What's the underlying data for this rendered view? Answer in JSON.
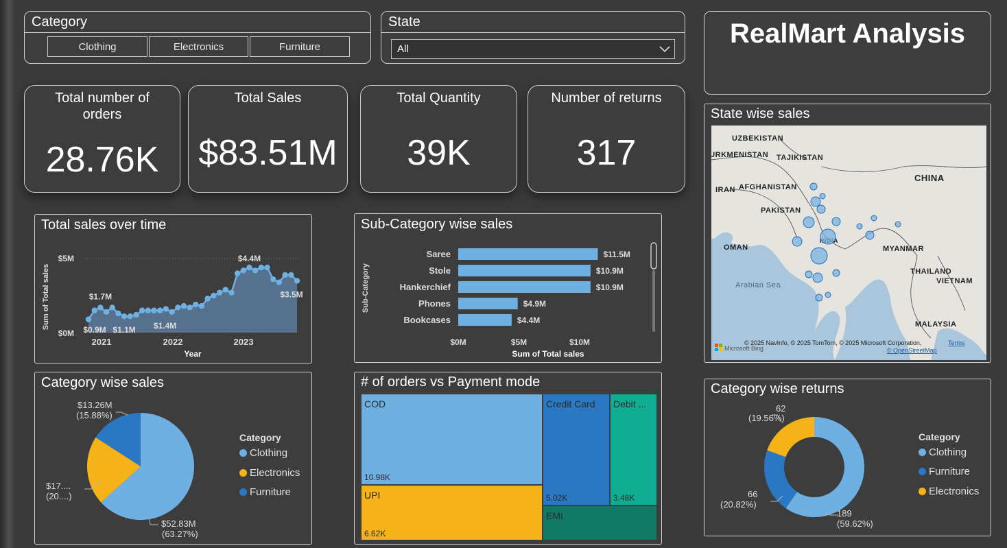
{
  "colors": {
    "light_blue": "#6fb0e2",
    "dark_blue": "#2a78c4",
    "yellow": "#f6b318",
    "teal": "#0fae92",
    "dark_teal": "#117a65",
    "panel": "#3d3d3d"
  },
  "slicers": {
    "category": {
      "title": "Category",
      "options": [
        "Clothing",
        "Electronics",
        "Furniture"
      ]
    },
    "state": {
      "title": "State",
      "selected": "All"
    }
  },
  "title": "RealMart Analysis",
  "kpis": [
    {
      "title": "Total number of orders",
      "value": "28.76K"
    },
    {
      "title": "Total Sales",
      "value": "$83.51M"
    },
    {
      "title": "Total Quantity",
      "value": "39K"
    },
    {
      "title": "Number of returns",
      "value": "317"
    }
  ],
  "sales_over_time": {
    "title": "Total sales over time",
    "chart_data": {
      "type": "area",
      "xlabel": "Year",
      "ylabel": "Sum of Total sales",
      "x_ticks": [
        "2021",
        "2022",
        "2023"
      ],
      "y_ticks": [
        "$0M",
        "$5M"
      ],
      "ylim": [
        0,
        5.8
      ],
      "values": [
        0.9,
        1.5,
        1.7,
        1.4,
        1.7,
        1.3,
        1.1,
        1.1,
        1.2,
        1.5,
        1.5,
        1.5,
        1.5,
        1.6,
        1.4,
        1.7,
        1.8,
        1.7,
        1.9,
        1.8,
        2.3,
        2.5,
        2.7,
        2.9,
        2.7,
        4.0,
        4.2,
        4.4,
        4.2,
        4.4,
        4.4,
        3.6,
        3.4,
        3.9,
        3.9,
        3.5
      ],
      "data_labels": [
        {
          "text": "$0.9M",
          "index": 0
        },
        {
          "text": "$1.7M",
          "index": 2
        },
        {
          "text": "$1.1M",
          "index": 6
        },
        {
          "text": "$1.4M",
          "index": 14
        },
        {
          "text": "$4.4M",
          "index": 27
        },
        {
          "text": "$3.5M",
          "index": 35
        }
      ]
    }
  },
  "subcategory_sales": {
    "title": "Sub-Category wise sales",
    "chart_data": {
      "type": "bar",
      "categories": [
        "Saree",
        "Stole",
        "Hankerchief",
        "Phones",
        "Bookcases"
      ],
      "values": [
        11.5,
        10.9,
        10.9,
        4.9,
        4.4
      ],
      "labels": [
        "$11.5M",
        "$10.9M",
        "$10.9M",
        "$4.9M",
        "$4.4M"
      ],
      "xlabel": "Sum of Total sales",
      "ylabel": "Sub-Category",
      "x_ticks": [
        "$0M",
        "$5M",
        "$10M"
      ],
      "xlim": [
        0,
        12.5
      ]
    }
  },
  "state_sales": {
    "title": "State wise sales",
    "map_labels": [
      "UZBEKISTAN",
      "TURKMENISTAN",
      "TAJIKISTAN",
      "IRAN",
      "AFGHANISTAN",
      "PAKISTAN",
      "CHINA",
      "OMAN",
      "INDIA",
      "MYANMAR",
      "Arabian Sea",
      "THAILAND",
      "VIETNAM",
      "MALAYSIA"
    ],
    "attribution": "© 2025 NavInfo, © 2025 TomTom, © 2025 Microsoft Corporation,",
    "terms": "Terms",
    "osm": "© OpenStreetMap",
    "bing": "Microsoft Bing"
  },
  "category_sales": {
    "title": "Category wise sales",
    "chart_data": {
      "type": "pie",
      "slices": [
        {
          "name": "Clothing",
          "value": 52.83,
          "label": "$52.83M",
          "pct": "(63.27%)"
        },
        {
          "name": "Electronics",
          "value": 17.42,
          "label": "$17....",
          "pct": "(20....)"
        },
        {
          "name": "Furniture",
          "value": 13.26,
          "label": "$13.26M",
          "pct": "(15.88%)"
        }
      ],
      "legend_title": "Category",
      "legend": [
        "Clothing",
        "Electronics",
        "Furniture"
      ]
    }
  },
  "payment_mode": {
    "title": "# of orders vs Payment mode",
    "chart_data": {
      "type": "treemap",
      "items": [
        {
          "name": "COD",
          "value": "10.98K"
        },
        {
          "name": "UPI",
          "value": "6.62K"
        },
        {
          "name": "Credit Card",
          "value": "5.02K"
        },
        {
          "name": "Debit ...",
          "value": "3.48K"
        },
        {
          "name": "EMI",
          "value": ""
        }
      ]
    }
  },
  "category_returns": {
    "title": "Category wise returns",
    "chart_data": {
      "type": "donut",
      "slices": [
        {
          "name": "Clothing",
          "value": 189,
          "label": "189",
          "pct": "(59.62%)"
        },
        {
          "name": "Furniture",
          "value": 66,
          "label": "66",
          "pct": "(20.82%)"
        },
        {
          "name": "Electronics",
          "value": 62,
          "label": "62",
          "pct": "(19.56%)"
        }
      ],
      "legend_title": "Category",
      "legend": [
        "Clothing",
        "Furniture",
        "Electronics"
      ]
    }
  }
}
